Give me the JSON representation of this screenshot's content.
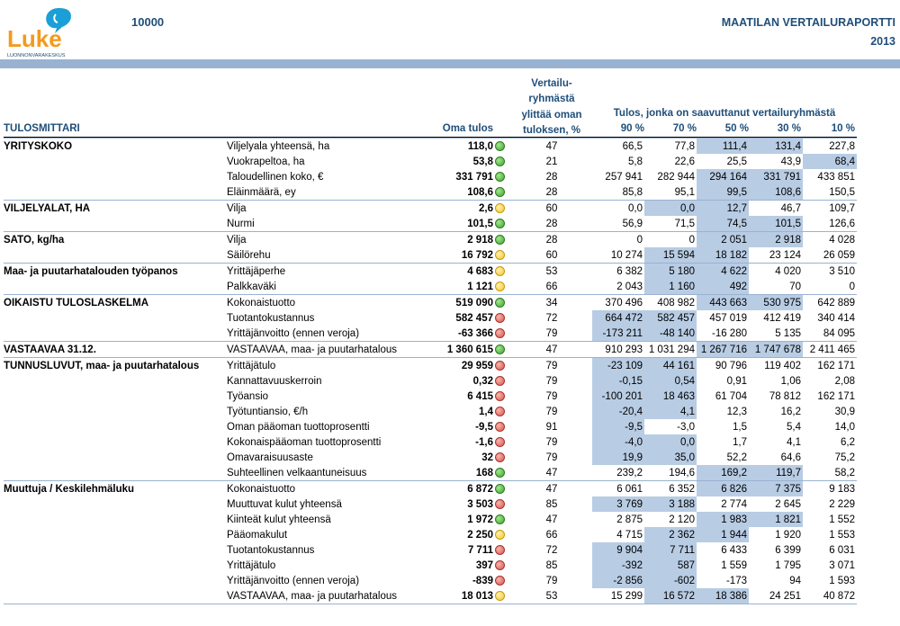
{
  "header": {
    "logo_text": "Luke",
    "logo_subtext": "LUONNONVARAKESKUS",
    "report_id": "10000",
    "report_title": "MAATILAN VERTAILURAPORTTI",
    "report_year": "2013"
  },
  "columns": {
    "tulosmittari": "TULOSMITTARI",
    "oma_tulos": "Oma tulos",
    "vertailu_lines": [
      "Vertailu-",
      "ryhmästä",
      "ylittää oman",
      "tuloksen, %"
    ],
    "tulos_joka": "Tulos, jonka on saavuttanut vertailuryhmästä",
    "percentiles": [
      "90 %",
      "70 %",
      "50 %",
      "30 %",
      "10 %"
    ]
  },
  "rows": [
    {
      "cat": "YRITYSKOKO",
      "ind": "Viljelyala yhteensä, ha",
      "own": "118,0",
      "dot": "green",
      "exc": "47",
      "p": [
        "66,5",
        "77,8",
        "111,4",
        "131,4",
        "227,8"
      ],
      "hl": [
        2,
        3
      ]
    },
    {
      "cat": "",
      "ind": "Vuokrapeltoa, ha",
      "own": "53,8",
      "dot": "green",
      "exc": "21",
      "p": [
        "5,8",
        "22,6",
        "25,5",
        "43,9",
        "68,4"
      ],
      "hl": [
        4
      ]
    },
    {
      "cat": "",
      "ind": "Taloudellinen koko, €",
      "own": "331 791",
      "dot": "green",
      "exc": "28",
      "p": [
        "257 941",
        "282 944",
        "294 164",
        "331 791",
        "433 851"
      ],
      "hl": [
        2,
        3
      ]
    },
    {
      "cat": "",
      "ind": "Eläinmäärä, ey",
      "own": "108,6",
      "dot": "green",
      "exc": "28",
      "p": [
        "85,8",
        "95,1",
        "99,5",
        "108,6",
        "150,5"
      ],
      "hl": [
        2,
        3
      ]
    },
    {
      "cat": "VILJELYALAT, HA",
      "ind": "Vilja",
      "own": "2,6",
      "dot": "yellow",
      "exc": "60",
      "p": [
        "0,0",
        "0,0",
        "12,7",
        "46,7",
        "109,7"
      ],
      "hl": [
        1,
        2
      ]
    },
    {
      "cat": "",
      "ind": "Nurmi",
      "own": "101,5",
      "dot": "green",
      "exc": "28",
      "p": [
        "56,9",
        "71,5",
        "74,5",
        "101,5",
        "126,6"
      ],
      "hl": [
        2,
        3
      ]
    },
    {
      "cat": "SATO, kg/ha",
      "ind": "Vilja",
      "own": "2 918",
      "dot": "green",
      "exc": "28",
      "p": [
        "0",
        "0",
        "2 051",
        "2 918",
        "4 028"
      ],
      "hl": [
        2,
        3
      ]
    },
    {
      "cat": "",
      "ind": "Säilörehu",
      "own": "16 792",
      "dot": "yellow",
      "exc": "60",
      "p": [
        "10 274",
        "15 594",
        "18 182",
        "23 124",
        "26 059"
      ],
      "hl": [
        1,
        2
      ]
    },
    {
      "cat": "Maa- ja puutarhatalouden työpanos",
      "ind": "Yrittäjäperhe",
      "own": "4 683",
      "dot": "yellow",
      "exc": "53",
      "p": [
        "6 382",
        "5 180",
        "4 622",
        "4 020",
        "3 510"
      ],
      "hl": [
        1,
        2
      ]
    },
    {
      "cat": "",
      "ind": "Palkkaväki",
      "own": "1 121",
      "dot": "yellow",
      "exc": "66",
      "p": [
        "2 043",
        "1 160",
        "492",
        "70",
        "0"
      ],
      "hl": [
        1,
        2
      ]
    },
    {
      "cat": "OIKAISTU TULOSLASKELMA",
      "ind": "Kokonaistuotto",
      "own": "519 090",
      "dot": "green",
      "exc": "34",
      "p": [
        "370 496",
        "408 982",
        "443 663",
        "530 975",
        "642 889"
      ],
      "hl": [
        2,
        3
      ]
    },
    {
      "cat": "",
      "ind": "Tuotantokustannus",
      "own": "582 457",
      "dot": "red",
      "exc": "72",
      "p": [
        "664 472",
        "582 457",
        "457 019",
        "412 419",
        "340 414"
      ],
      "hl": [
        0,
        1
      ]
    },
    {
      "cat": "",
      "ind": "Yrittäjänvoitto (ennen veroja)",
      "own": "-63 366",
      "dot": "red",
      "exc": "79",
      "p": [
        "-173 211",
        "-48 140",
        "-16 280",
        "5 135",
        "84 095"
      ],
      "hl": [
        0,
        1
      ]
    },
    {
      "cat": "VASTAAVAA 31.12.",
      "ind": "VASTAAVAA, maa- ja puutarhatalous",
      "own": "1 360 615",
      "dot": "green",
      "exc": "47",
      "p": [
        "910 293",
        "1 031 294",
        "1 267 716",
        "1 747 678",
        "2 411 465"
      ],
      "hl": [
        2,
        3
      ]
    },
    {
      "cat": "TUNNUSLUVUT, maa- ja puutarhatalous",
      "ind": "Yrittäjätulo",
      "own": "29 959",
      "dot": "red",
      "exc": "79",
      "p": [
        "-23 109",
        "44 161",
        "90 796",
        "119 402",
        "162 171"
      ],
      "hl": [
        0,
        1
      ]
    },
    {
      "cat": "",
      "ind": "Kannattavuuskerroin",
      "own": "0,32",
      "dot": "red",
      "exc": "79",
      "p": [
        "-0,15",
        "0,54",
        "0,91",
        "1,06",
        "2,08"
      ],
      "hl": [
        0,
        1
      ]
    },
    {
      "cat": "",
      "ind": "Työansio",
      "own": "6 415",
      "dot": "red",
      "exc": "79",
      "p": [
        "-100 201",
        "18 463",
        "61 704",
        "78 812",
        "162 171"
      ],
      "hl": [
        0,
        1
      ]
    },
    {
      "cat": "",
      "ind": "Työtuntiansio, €/h",
      "own": "1,4",
      "dot": "red",
      "exc": "79",
      "p": [
        "-20,4",
        "4,1",
        "12,3",
        "16,2",
        "30,9"
      ],
      "hl": [
        0,
        1
      ]
    },
    {
      "cat": "",
      "ind": "Oman pääoman tuottoprosentti",
      "own": "-9,5",
      "dot": "red",
      "exc": "91",
      "p": [
        "-9,5",
        "-3,0",
        "1,5",
        "5,4",
        "14,0"
      ],
      "hl": [
        0
      ]
    },
    {
      "cat": "",
      "ind": "Kokonaispääoman tuottoprosentti",
      "own": "-1,6",
      "dot": "red",
      "exc": "79",
      "p": [
        "-4,0",
        "0,0",
        "1,7",
        "4,1",
        "6,2"
      ],
      "hl": [
        0,
        1
      ]
    },
    {
      "cat": "",
      "ind": "Omavaraisuusaste",
      "own": "32",
      "dot": "red",
      "exc": "79",
      "p": [
        "19,9",
        "35,0",
        "52,2",
        "64,6",
        "75,2"
      ],
      "hl": [
        0,
        1
      ]
    },
    {
      "cat": "",
      "ind": "Suhteellinen velkaantuneisuus",
      "own": "168",
      "dot": "green",
      "exc": "47",
      "p": [
        "239,2",
        "194,6",
        "169,2",
        "119,7",
        "58,2"
      ],
      "hl": [
        2,
        3
      ]
    },
    {
      "cat": "Muuttuja / Keskilehmäluku",
      "ind": "Kokonaistuotto",
      "own": "6 872",
      "dot": "green",
      "exc": "47",
      "p": [
        "6 061",
        "6 352",
        "6 826",
        "7 375",
        "9 183"
      ],
      "hl": [
        2,
        3
      ]
    },
    {
      "cat": "",
      "ind": "Muuttuvat kulut yhteensä",
      "own": "3 503",
      "dot": "red",
      "exc": "85",
      "p": [
        "3 769",
        "3 188",
        "2 774",
        "2 645",
        "2 229"
      ],
      "hl": [
        0,
        1
      ]
    },
    {
      "cat": "",
      "ind": "Kiinteät kulut yhteensä",
      "own": "1 972",
      "dot": "green",
      "exc": "47",
      "p": [
        "2 875",
        "2 120",
        "1 983",
        "1 821",
        "1 552"
      ],
      "hl": [
        2,
        3
      ]
    },
    {
      "cat": "",
      "ind": "Pääomakulut",
      "own": "2 250",
      "dot": "yellow",
      "exc": "66",
      "p": [
        "4 715",
        "2 362",
        "1 944",
        "1 920",
        "1 553"
      ],
      "hl": [
        1,
        2
      ]
    },
    {
      "cat": "",
      "ind": "Tuotantokustannus",
      "own": "7 711",
      "dot": "red",
      "exc": "72",
      "p": [
        "9 904",
        "7 711",
        "6 433",
        "6 399",
        "6 031"
      ],
      "hl": [
        0,
        1
      ]
    },
    {
      "cat": "",
      "ind": "Yrittäjätulo",
      "own": "397",
      "dot": "red",
      "exc": "85",
      "p": [
        "-392",
        "587",
        "1 559",
        "1 795",
        "3 071"
      ],
      "hl": [
        0,
        1
      ]
    },
    {
      "cat": "",
      "ind": "Yrittäjänvoitto (ennen veroja)",
      "own": "-839",
      "dot": "red",
      "exc": "79",
      "p": [
        "-2 856",
        "-602",
        "-173",
        "94",
        "1 593"
      ],
      "hl": [
        0,
        1
      ]
    },
    {
      "cat": "",
      "ind": "VASTAAVAA, maa- ja puutarhatalous",
      "own": "18 013",
      "dot": "yellow",
      "exc": "53",
      "p": [
        "15 299",
        "16 572",
        "18 386",
        "24 251",
        "40 872"
      ],
      "hl": [
        1,
        2
      ]
    }
  ],
  "colors": {
    "header_blue": "#1f4e79",
    "band": "#9ab2d1",
    "highlight": "#b8cce4",
    "logo_orange": "#f39a1f",
    "logo_blue": "#1a9fd6"
  }
}
